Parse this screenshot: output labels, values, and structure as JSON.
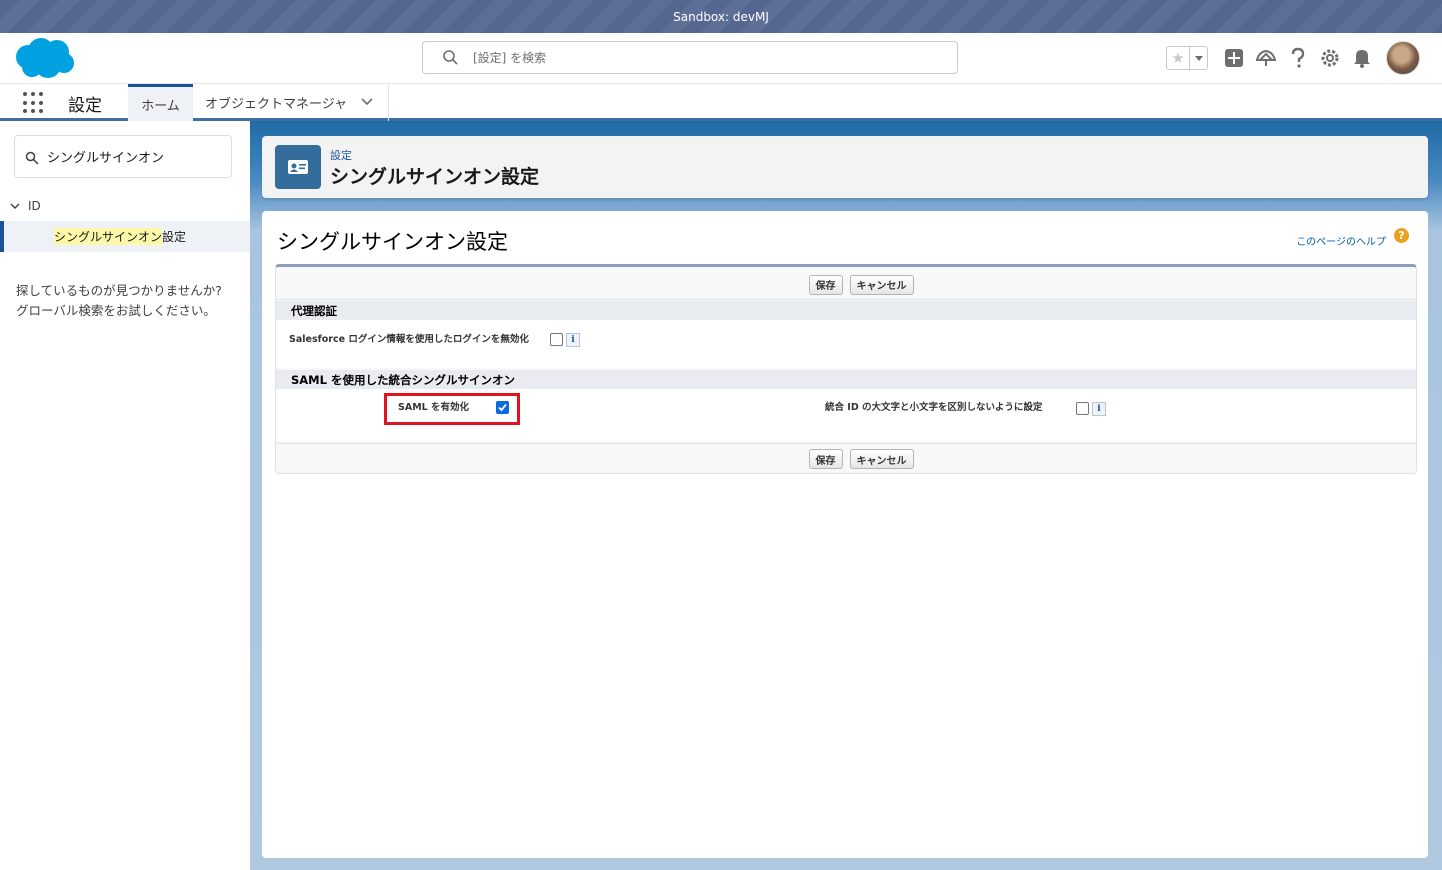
{
  "sandbox_label": "Sandbox: devMJ",
  "search": {
    "placeholder": "[設定] を検索"
  },
  "app": {
    "name": "設定"
  },
  "tabs": [
    {
      "label": "ホーム"
    },
    {
      "label": "オブジェクトマネージャ"
    }
  ],
  "sidebar": {
    "quickfind_value": "シングルサインオン",
    "node_label": "ID",
    "leaf_highlight": "シングルサインオン",
    "leaf_suffix": "設定",
    "notfound_line1": "探しているものが見つかりませんか?",
    "notfound_line2": "グローバル検索をお試しください。"
  },
  "page_header": {
    "breadcrumb": "設定",
    "title": "シングルサインオン設定"
  },
  "content": {
    "title": "シングルサインオン設定",
    "help_link": "このページのヘルプ",
    "help_icon_glyph": "?",
    "save_label": "保存",
    "cancel_label": "キャンセル",
    "section1": {
      "title": "代理認証",
      "field_label": "Salesforce ログイン情報を使用したログインを無効化",
      "checked": false
    },
    "section2": {
      "title": "SAML を使用した統合シングルサインオン",
      "saml_label": "SAML を有効化",
      "saml_checked": true,
      "case_label": "統合 ID の大文字と小文字を区別しないように設定",
      "case_checked": false
    },
    "info_glyph": "i"
  },
  "colors": {
    "brand_blue": "#1b5297",
    "highlight_red": "#e0141f",
    "checkbox_blue": "#0b6bdc"
  },
  "icons": [
    "salesforce-cloud-logo",
    "search-icon",
    "star-icon",
    "chevron-down-icon",
    "plus-icon",
    "trailhead-icon",
    "help-icon",
    "gear-icon",
    "bell-icon",
    "app-launcher-icon",
    "identity-card-icon",
    "info-icon"
  ]
}
